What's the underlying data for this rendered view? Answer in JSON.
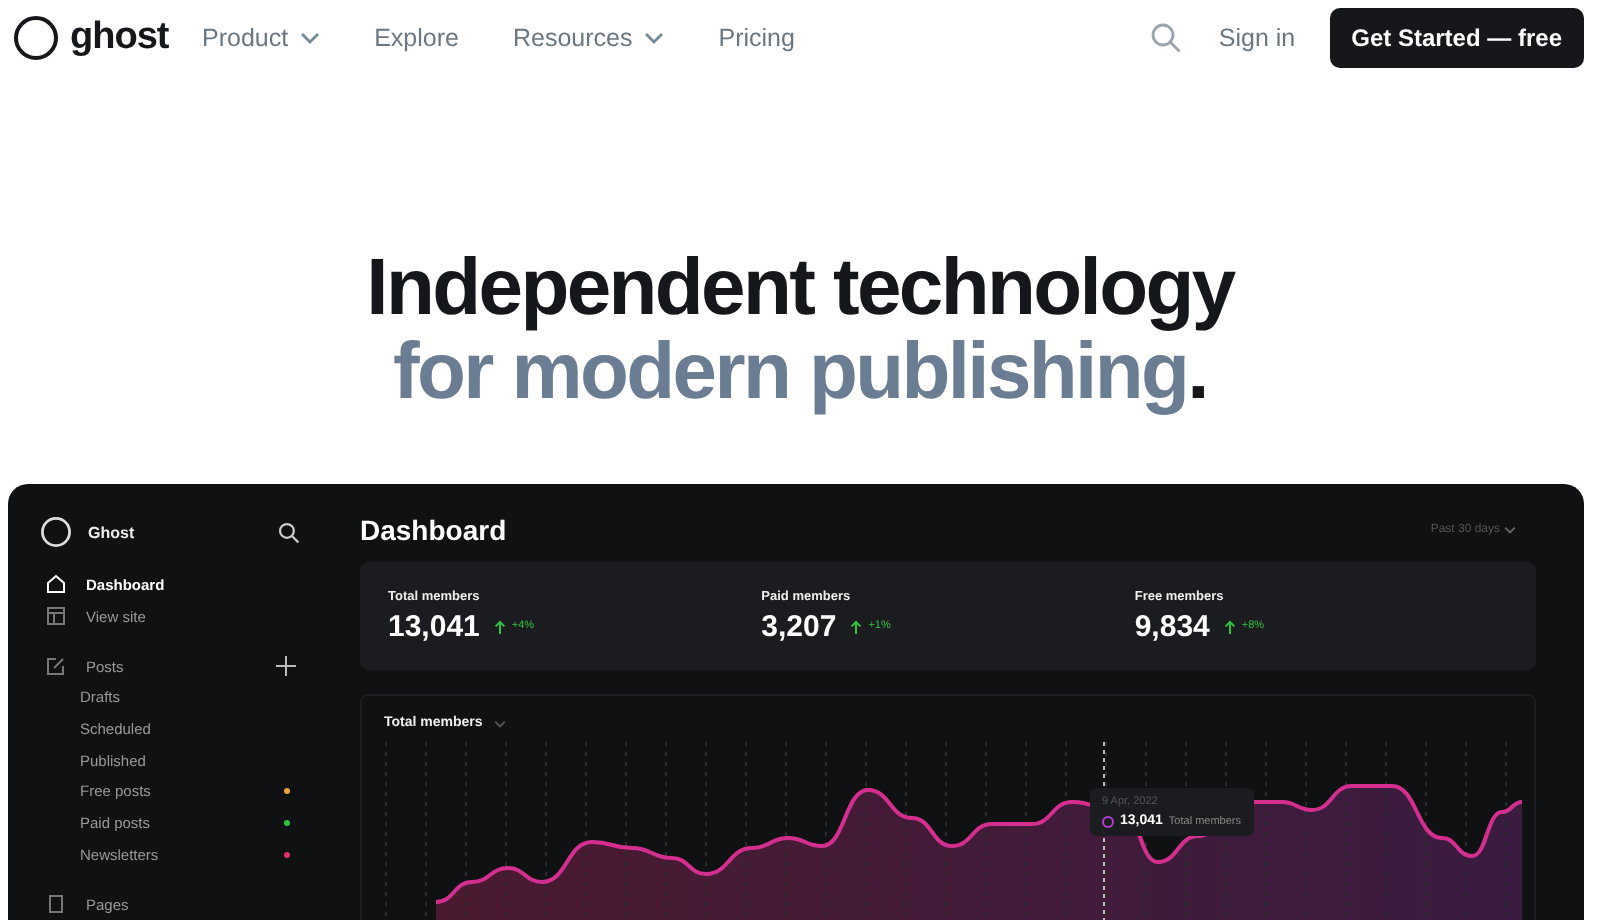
{
  "nav": {
    "brand": "ghost",
    "links": [
      {
        "label": "Product",
        "dropdown": true
      },
      {
        "label": "Explore",
        "dropdown": false
      },
      {
        "label": "Resources",
        "dropdown": true
      },
      {
        "label": "Pricing",
        "dropdown": false
      }
    ],
    "sign_in": "Sign in",
    "cta": "Get Started — free"
  },
  "hero": {
    "line_1": "Independent technology",
    "line_2": "for modern publishing",
    "line_2_end": "."
  },
  "dashboard": {
    "site_name": "Ghost",
    "sidebar": [
      {
        "label": "Dashboard",
        "selected": true
      },
      {
        "label": "View site",
        "selected": false
      },
      {
        "label": "Posts",
        "selected": false,
        "add": true,
        "children": [
          {
            "label": "Drafts"
          },
          {
            "label": "Scheduled"
          },
          {
            "label": "Published"
          },
          {
            "label": "Free posts",
            "color": "#e8a43a"
          },
          {
            "label": "Paid posts",
            "color": "#30c43e"
          },
          {
            "label": "Newsletters",
            "color": "#e0306f"
          }
        ]
      },
      {
        "label": "Pages",
        "selected": false
      }
    ],
    "title": "Dashboard",
    "range": "Past 30 days",
    "stats": [
      {
        "label": "Total members",
        "value": "13,041",
        "change": "+4%"
      },
      {
        "label": "Paid members",
        "value": "3,207",
        "change": "+1%"
      },
      {
        "label": "Free members",
        "value": "9,834",
        "change": "+8%"
      }
    ],
    "chart": {
      "title": "Total members",
      "tooltip": {
        "date": "9 Apr, 2022",
        "value": "13,041",
        "label": "Total members"
      }
    }
  }
}
